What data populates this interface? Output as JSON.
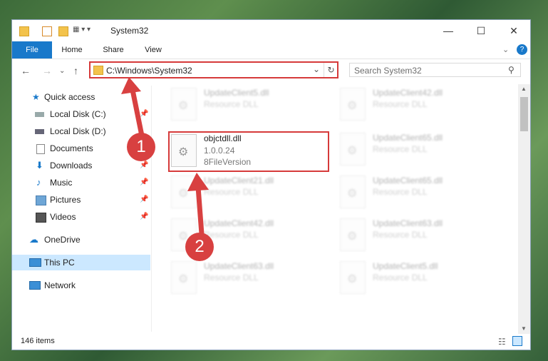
{
  "window": {
    "title": "System32"
  },
  "ribbon": {
    "file": "File",
    "home": "Home",
    "share": "Share",
    "view": "View"
  },
  "address": {
    "path": "C:\\Windows\\System32"
  },
  "search": {
    "placeholder": "Search System32"
  },
  "sidebar": {
    "items": [
      {
        "label": "Quick access"
      },
      {
        "label": "Local Disk (C:)"
      },
      {
        "label": "Local Disk (D:)"
      },
      {
        "label": "Documents"
      },
      {
        "label": "Downloads"
      },
      {
        "label": "Music"
      },
      {
        "label": "Pictures"
      },
      {
        "label": "Videos"
      },
      {
        "label": "OneDrive"
      },
      {
        "label": "This PC"
      },
      {
        "label": "Network"
      }
    ]
  },
  "files": {
    "highlight": {
      "name": "objctdll.dll",
      "version": "1.0.0.24",
      "desc": "8FileVersion"
    },
    "left": [
      {
        "name": "UpdateClient5.dll",
        "desc": "Resource DLL"
      },
      {
        "name": "UpdateClient21.dll",
        "desc": "Resource DLL"
      },
      {
        "name": "UpdateClient42.dll",
        "desc": "Resource DLL"
      },
      {
        "name": "UpdateClient63.dll",
        "desc": "Resource DLL"
      }
    ],
    "right": [
      {
        "name": "UpdateClient42.dll",
        "desc": "Resource DLL"
      },
      {
        "name": "UpdateClient65.dll",
        "desc": "Resource DLL"
      },
      {
        "name": "UpdateClient65.dll",
        "desc": "Resource DLL"
      },
      {
        "name": "UpdateClient63.dll",
        "desc": "Resource DLL"
      },
      {
        "name": "UpdateClient5.dll",
        "desc": "Resource DLL"
      }
    ]
  },
  "status": {
    "items": "146 items"
  },
  "annotations": {
    "badge1": "1",
    "badge2": "2"
  }
}
